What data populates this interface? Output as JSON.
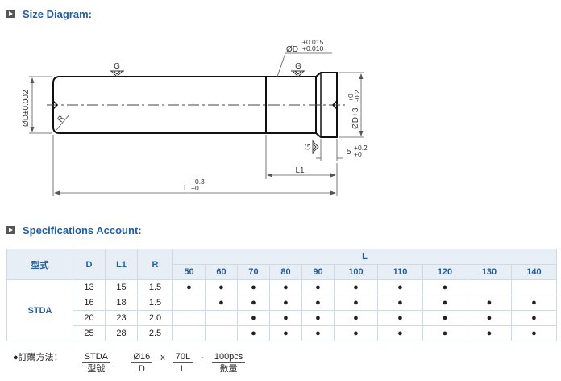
{
  "sections": {
    "size_title": "Size Diagram:",
    "spec_title": "Specifications Account:"
  },
  "diagram": {
    "left_dia": "ØD±0.002",
    "left_radius": "R",
    "top_dia_main": "ØD",
    "top_dia_tol_plus": "+0.015",
    "top_dia_tol_minus": "+0.010",
    "grind_g": "G",
    "right_dia_main": "ØD+3",
    "right_dia_tol_plus": "+0",
    "right_dia_tol_minus": "-0.2",
    "head_len_main": "5",
    "head_len_tol_plus": "+0.2",
    "head_len_tol_minus": "+0",
    "l1_label": "L1",
    "l_main": "L",
    "l_tol_plus": "+0.3",
    "l_tol_minus": "+0"
  },
  "table": {
    "col_model": "型式",
    "col_d": "D",
    "col_l1": "L1",
    "col_r": "R",
    "col_l": "L",
    "l_values": [
      "50",
      "60",
      "70",
      "80",
      "90",
      "100",
      "110",
      "120",
      "130",
      "140"
    ],
    "model": "STDA",
    "dot": "●",
    "rows": [
      {
        "d": "13",
        "l1": "15",
        "r": "1.5",
        "avail": [
          1,
          1,
          1,
          1,
          1,
          1,
          1,
          1,
          0,
          0
        ]
      },
      {
        "d": "16",
        "l1": "18",
        "r": "1.5",
        "avail": [
          0,
          1,
          1,
          1,
          1,
          1,
          1,
          1,
          1,
          1
        ]
      },
      {
        "d": "20",
        "l1": "23",
        "r": "2.0",
        "avail": [
          0,
          0,
          1,
          1,
          1,
          1,
          1,
          1,
          1,
          1
        ]
      },
      {
        "d": "25",
        "l1": "28",
        "r": "2.5",
        "avail": [
          0,
          0,
          1,
          1,
          1,
          1,
          1,
          1,
          1,
          1
        ]
      }
    ]
  },
  "order": {
    "lead": "●訂購方法：",
    "p1_top": "STDA",
    "p1_bot": "型號",
    "p2_top": "Ø16",
    "p2_bot": "D",
    "x_sep": "x",
    "p3_top": "70L",
    "p3_bot": "L",
    "dash_sep": "-",
    "p4_top": "100pcs",
    "p4_bot": "數量"
  }
}
